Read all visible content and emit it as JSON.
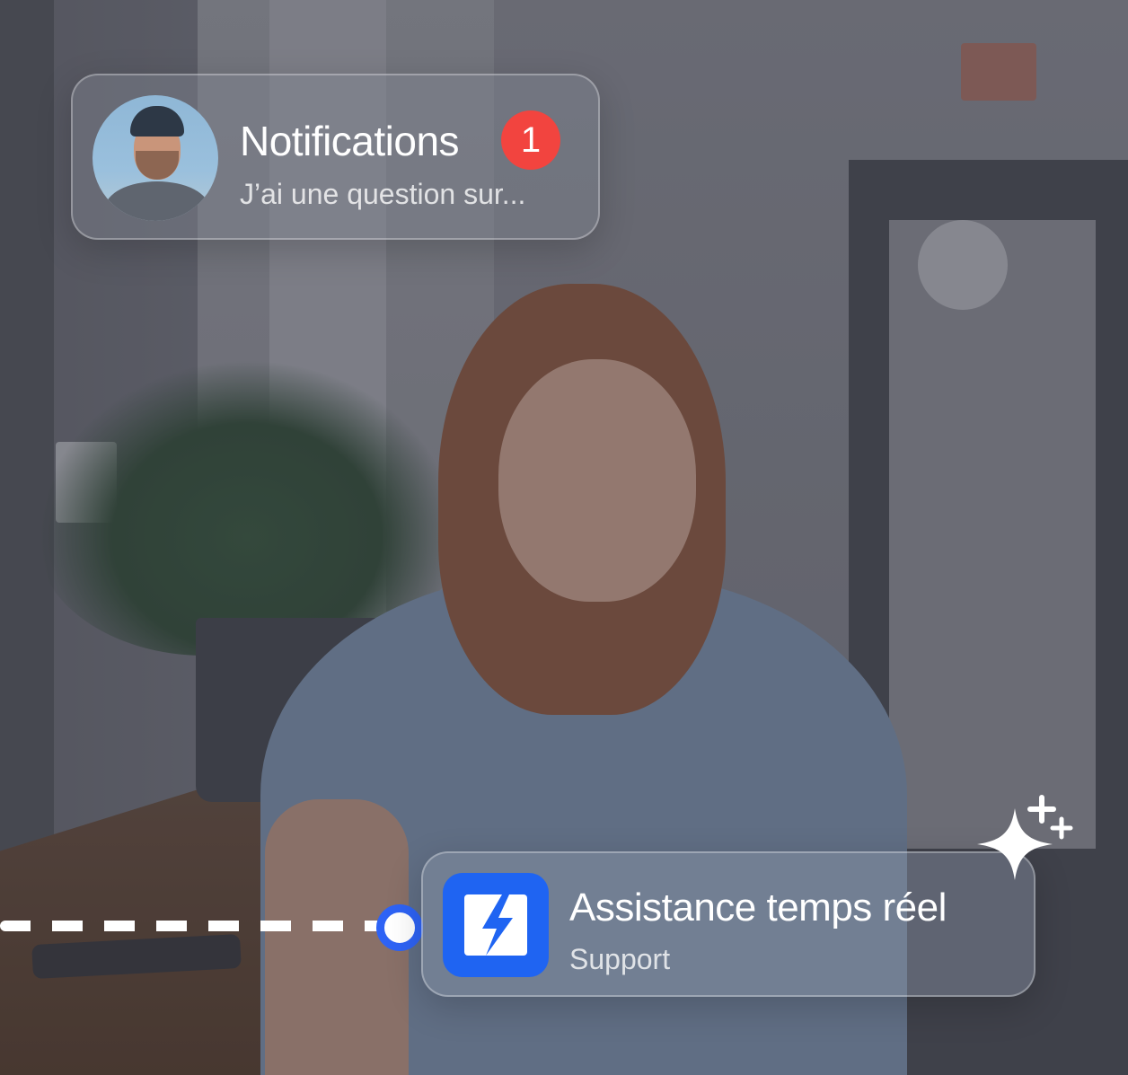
{
  "notification": {
    "title": "Notifications",
    "badge_count": "1",
    "preview": "J’ai une question sur...",
    "badge_color": "#f2443f"
  },
  "assistance": {
    "title": "Assistance temps réel",
    "subtitle": "Support",
    "icon": "bolt-icon",
    "accent_color": "#1f64f2"
  },
  "decorations": {
    "sparkle_icon": "sparkle-icon",
    "connector_color": "#ffffff"
  }
}
